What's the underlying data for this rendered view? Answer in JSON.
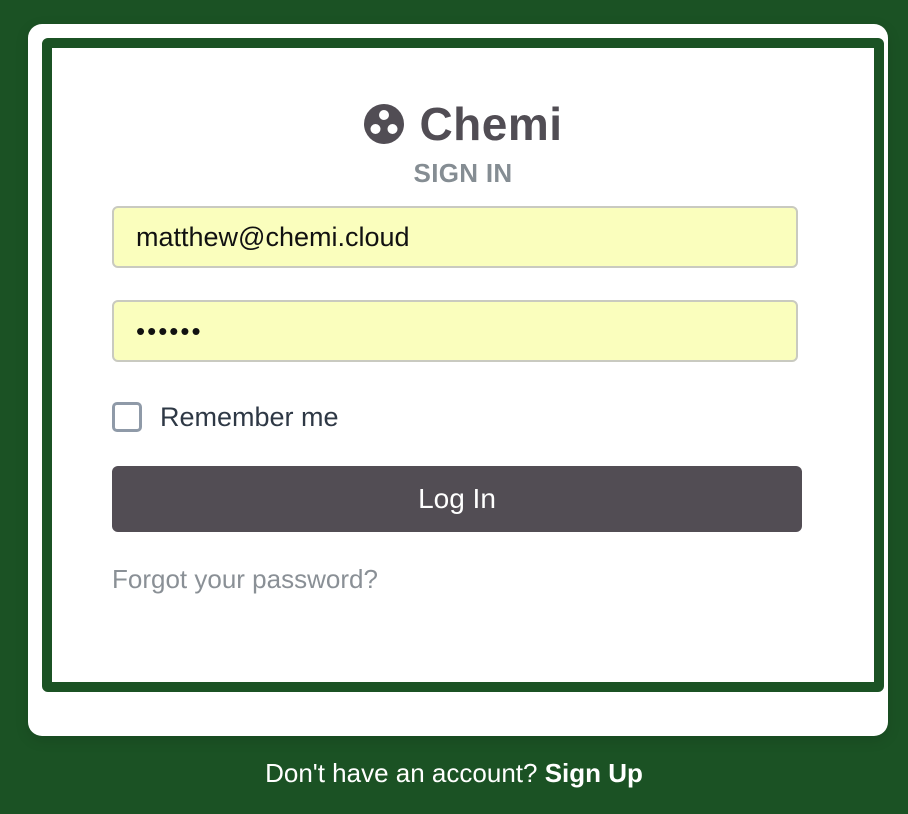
{
  "brand": {
    "name": "Chemi",
    "icon": "molecule-logo-icon"
  },
  "form": {
    "title": "SIGN IN",
    "email_value": "matthew@chemi.cloud",
    "password_value": "••••••",
    "remember_label": "Remember me",
    "remember_checked": false,
    "login_label": "Log In",
    "forgot_label": "Forgot your password?"
  },
  "footer": {
    "prompt": "Don't have an account?",
    "signup_label": "Sign Up"
  },
  "colors": {
    "background": "#1b5224",
    "button": "#524d54",
    "input_fill": "#fafebd",
    "brand_text": "#514d54",
    "muted_text": "#858d93"
  }
}
